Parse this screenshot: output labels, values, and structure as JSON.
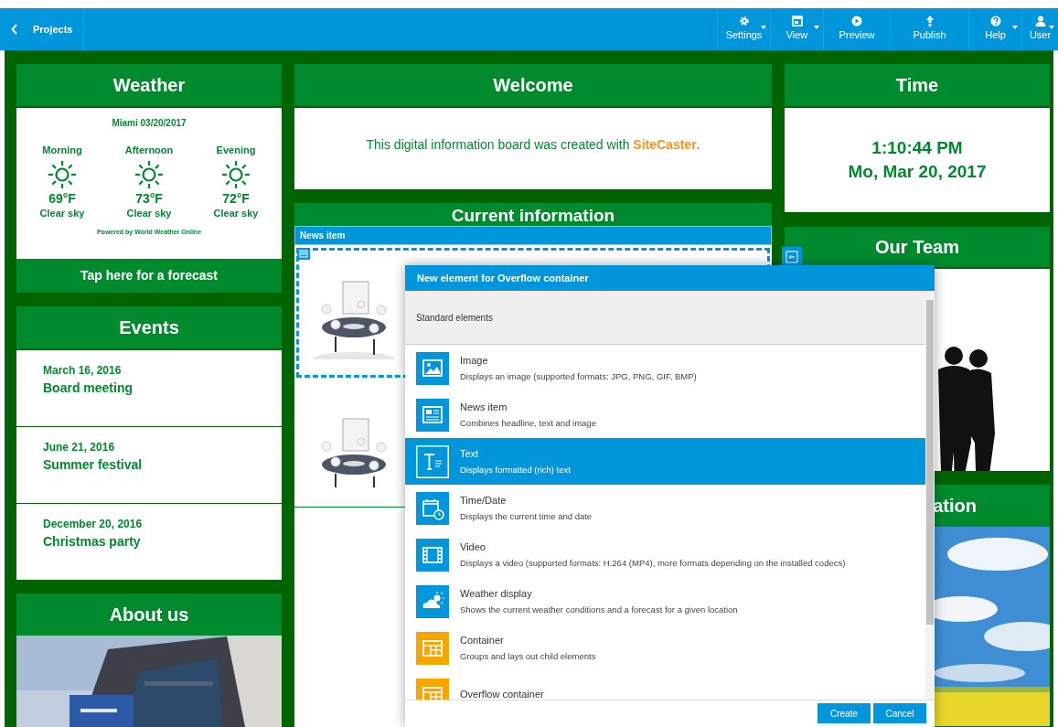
{
  "toolbar": {
    "back_label": "Projects",
    "items": [
      {
        "label": "Settings",
        "has_menu": true
      },
      {
        "label": "View",
        "has_menu": true
      },
      {
        "label": "Preview",
        "has_menu": false
      },
      {
        "label": "Publish",
        "has_menu": false
      },
      {
        "label": "Help",
        "has_menu": true
      },
      {
        "label": "User",
        "has_menu": true
      }
    ]
  },
  "weather": {
    "title": "Weather",
    "location": "Miami 03/20/2017",
    "periods": [
      {
        "name": "Morning",
        "temp": "69°F",
        "condition": "Clear sky"
      },
      {
        "name": "Afternoon",
        "temp": "73°F",
        "condition": "Clear sky"
      },
      {
        "name": "Evening",
        "temp": "72°F",
        "condition": "Clear sky"
      }
    ],
    "credit": "Powered by World Weather Online",
    "forecast_link": "Tap here for a forecast"
  },
  "events": {
    "title": "Events",
    "items": [
      {
        "date": "March 16, 2016",
        "name": "Board meeting"
      },
      {
        "date": "June 21, 2016",
        "name": "Summer festival"
      },
      {
        "date": "December 20, 2016",
        "name": "Christmas party"
      }
    ]
  },
  "about": {
    "title": "About us"
  },
  "welcome": {
    "title": "Welcome",
    "text": "This digital information board was created with **SiteCaster**."
  },
  "current_information": {
    "title": "Current information",
    "selected_element": "News item"
  },
  "time": {
    "title": "Time",
    "clock": "1:10:44 PM",
    "date": "Mo, Mar 20, 2017"
  },
  "team": {
    "title": "Our Team"
  },
  "right_panel_3": {
    "title": "ation"
  },
  "dialog": {
    "title": "New element for Overflow container",
    "section": "Standard elements",
    "items": [
      {
        "name": "Image",
        "description": "Displays an image (supported formats: JPG, PNG, GIF, BMP)",
        "color": "#0096dc",
        "selected": false
      },
      {
        "name": "News item",
        "description": "Combines headline, text and image",
        "color": "#0096dc",
        "selected": false
      },
      {
        "name": "Text",
        "description": "Displays formatted (rich) text",
        "color": "#0096dc",
        "selected": true
      },
      {
        "name": "Time/Date",
        "description": "Displays the current time and date",
        "color": "#0096dc",
        "selected": false
      },
      {
        "name": "Video",
        "description": "Displays a video (supported formats: H.264 (MP4), more formats depending on the installed codecs)",
        "color": "#0096dc",
        "selected": false
      },
      {
        "name": "Weather display",
        "description": "Shows the current weather conditions and a forecast for a given location",
        "color": "#0096dc",
        "selected": false
      },
      {
        "name": "Container",
        "description": "Groups and lays out child elements",
        "color": "#f7a600",
        "selected": false
      },
      {
        "name": "Overflow container",
        "color": "#f7a600",
        "selected": false
      }
    ],
    "buttons": [
      "Create",
      "Cancel"
    ]
  }
}
